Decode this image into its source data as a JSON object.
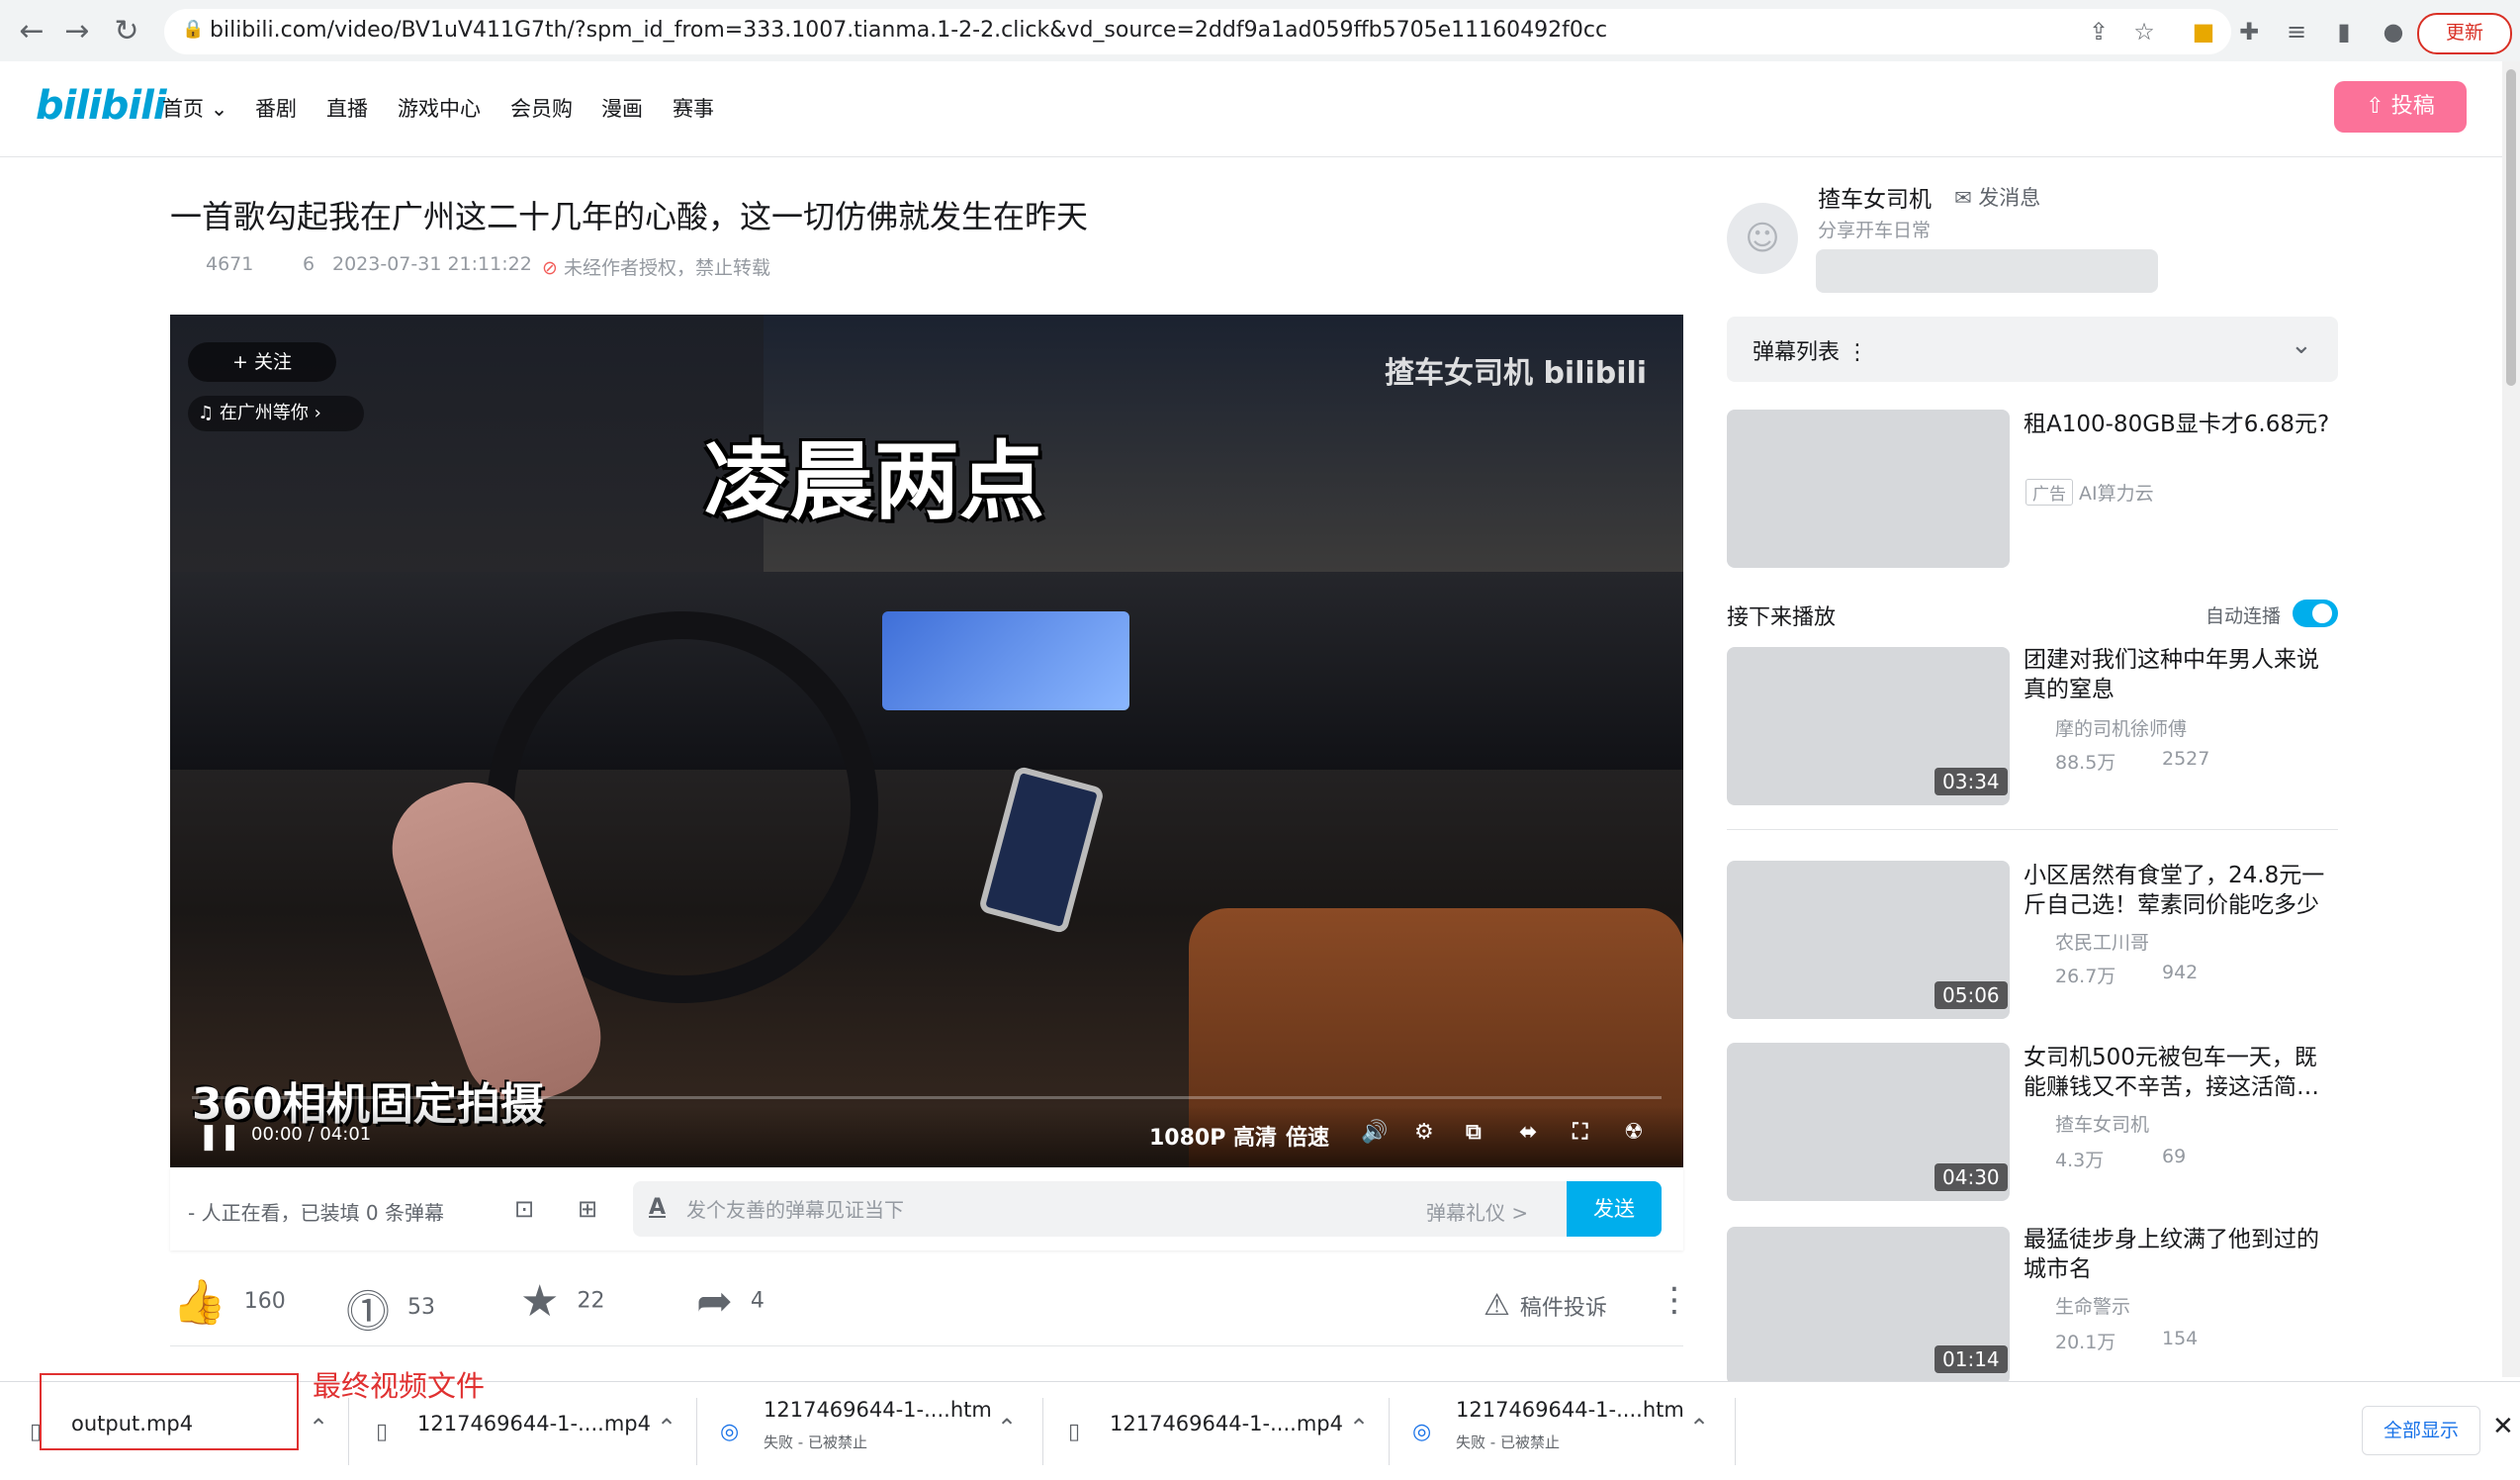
{
  "browser": {
    "url": "bilibili.com/video/BV1uV411G7th/?spm_id_from=333.1007.tianma.1-2-2.click&vd_source=2ddf9a1ad059ffb5705e11160492f0cc",
    "update_label": "更新"
  },
  "header": {
    "logo": "bilibili",
    "nav": [
      "首页",
      "番剧",
      "直播",
      "游戏中心",
      "会员购",
      "漫画",
      "赛事"
    ],
    "upload_label": "投稿"
  },
  "video": {
    "title": "一首歌勾起我在广州这二十几年的心酸，这一切仿佛就发生在昨天",
    "views": "4671",
    "danmaku_count": "6",
    "datetime": "2023-07-31 21:11:22",
    "no_repost": "未经作者授权，禁止转载"
  },
  "player": {
    "overlay_top": "凌晨两点",
    "overlay_bottom": "360相机固定拍摄",
    "watermark": "揸车女司机 bilibili",
    "follow": "+ 关注",
    "music_tag": "在广州等你",
    "time": "00:00 / 04:01",
    "quality": "1080P 高清",
    "speed": "倍速"
  },
  "danmaku": {
    "viewers": "- 人正在看，已装填 0 条弹幕",
    "placeholder": "发个友善的弹幕见证当下",
    "etiquette": "弹幕礼仪 >",
    "send": "发送"
  },
  "actions": {
    "like": "160",
    "coin": "53",
    "favorite": "22",
    "share": "4",
    "report": "稿件投诉"
  },
  "uploader": {
    "name": "揸车女司机",
    "send_message": "发消息",
    "description": "分享开车日常"
  },
  "sidebar": {
    "danmu_list": "弹幕列表",
    "ad": {
      "title": "租A100-80GB显卡才6.68元?",
      "tag": "广告",
      "source": "AI算力云"
    },
    "next_label": "接下来播放",
    "autoplay_label": "自动连播",
    "autoplay_on": true,
    "recommendations": [
      {
        "title": "团建对我们这种中年男人来说真的窒息",
        "author": "摩的司机徐师傅",
        "views": "88.5万",
        "danmaku": "2527",
        "duration": "03:34"
      },
      {
        "title": "小区居然有食堂了，24.8元一斤自己选！荤素同价能吃多少",
        "author": "农民工川哥",
        "views": "26.7万",
        "danmaku": "942",
        "duration": "05:06"
      },
      {
        "title": "女司机500元被包车一天，既能赚钱又不辛苦，接这活简…",
        "author": "揸车女司机",
        "views": "4.3万",
        "danmaku": "69",
        "duration": "04:30"
      },
      {
        "title": "最猛徒步身上纹满了他到过的城市名",
        "author": "生命警示",
        "views": "20.1万",
        "danmaku": "154",
        "duration": "01:14"
      }
    ]
  },
  "downloads": {
    "items": [
      {
        "name": "output.mp4",
        "status": ""
      },
      {
        "name": "1217469644-1-....mp4",
        "status": ""
      },
      {
        "name": "1217469644-1-....htm",
        "status": "失败 - 已被禁止"
      },
      {
        "name": "1217469644-1-....mp4",
        "status": ""
      },
      {
        "name": "1217469644-1-....htm",
        "status": "失败 - 已被禁止"
      }
    ],
    "show_all": "全部显示",
    "annotation": "最终视频文件"
  },
  "colors": {
    "brand_pink": "#fb7299",
    "brand_blue": "#00aeec",
    "annotation_red": "#e03131"
  }
}
